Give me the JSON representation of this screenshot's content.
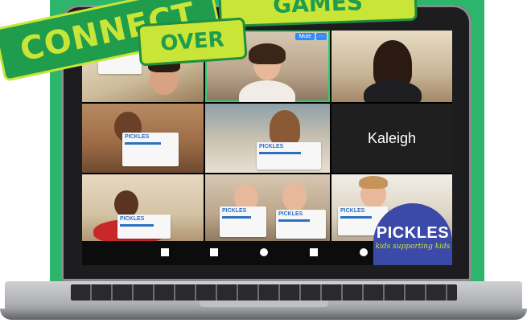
{
  "banners": {
    "connect": "CONNECT",
    "over": "OVER",
    "games": "GAMES"
  },
  "meeting": {
    "speaker_controls": {
      "mute": "Mute",
      "more": "···"
    },
    "name_tile": "Kaleigh",
    "sign_text": "PICKLES"
  },
  "logo": {
    "word": "PICKLES",
    "tagline": "kids supporting kids"
  },
  "colors": {
    "background_green": "#2db56c",
    "banner_lime": "#c9e537",
    "logo_blue": "#3b4aa8",
    "speaker_highlight": "#29d36a"
  }
}
